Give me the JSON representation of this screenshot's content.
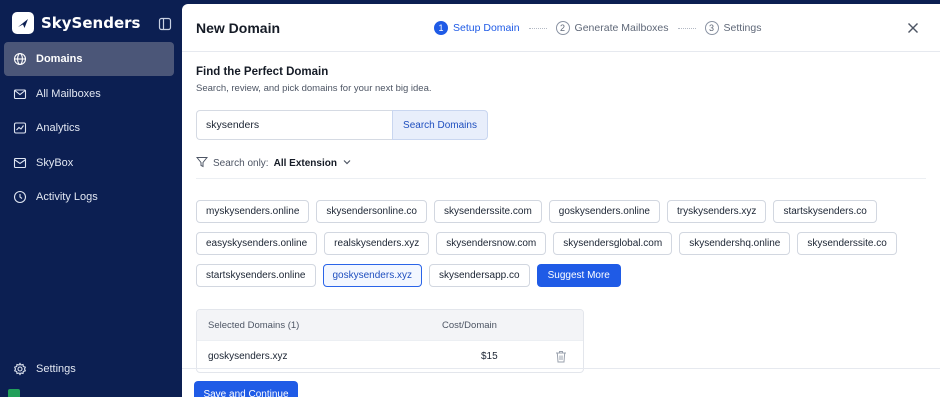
{
  "app": {
    "name": "SkySenders"
  },
  "sidebar": {
    "items": [
      {
        "label": "Domains",
        "icon": "globe-icon",
        "active": true
      },
      {
        "label": "All Mailboxes",
        "icon": "mail-icon"
      },
      {
        "label": "Analytics",
        "icon": "chart-icon"
      },
      {
        "label": "SkyBox",
        "icon": "inbox-icon"
      },
      {
        "label": "Activity Logs",
        "icon": "clock-icon"
      }
    ],
    "settings_label": "Settings"
  },
  "modal": {
    "title": "New Domain",
    "steps": [
      {
        "num": "1",
        "label": "Setup Domain",
        "active": true
      },
      {
        "num": "2",
        "label": "Generate Mailboxes"
      },
      {
        "num": "3",
        "label": "Settings"
      }
    ],
    "section_title": "Find the Perfect Domain",
    "section_subtitle": "Search, review, and pick domains for your next big idea.",
    "search": {
      "value": "skysenders",
      "button": "Search Domains"
    },
    "filter": {
      "prefix": "Search only:",
      "value": "All Extension"
    },
    "domains": [
      [
        "myskysenders.online",
        "skysendersonline.co",
        "skysenderssite.com",
        "goskysenders.online",
        "tryskysenders.xyz",
        "startskysenders.co"
      ],
      [
        "easyskysenders.online",
        "realskysenders.xyz",
        "skysendersnow.com",
        "skysendersglobal.com",
        "skysendershq.online",
        "skysenderssite.co"
      ],
      [
        "startskysenders.online",
        "goskysenders.xyz",
        "skysendersapp.co"
      ]
    ],
    "selected_domain": "goskysenders.xyz",
    "suggest_more": "Suggest More",
    "table": {
      "col_domains": "Selected Domains (1)",
      "col_cost": "Cost/Domain",
      "rows": [
        {
          "domain": "goskysenders.xyz",
          "price": "$15"
        }
      ]
    },
    "save_button": "Save and Continue"
  },
  "colors": {
    "accent": "#1f5be6",
    "sidebar": "#0c1f52"
  }
}
